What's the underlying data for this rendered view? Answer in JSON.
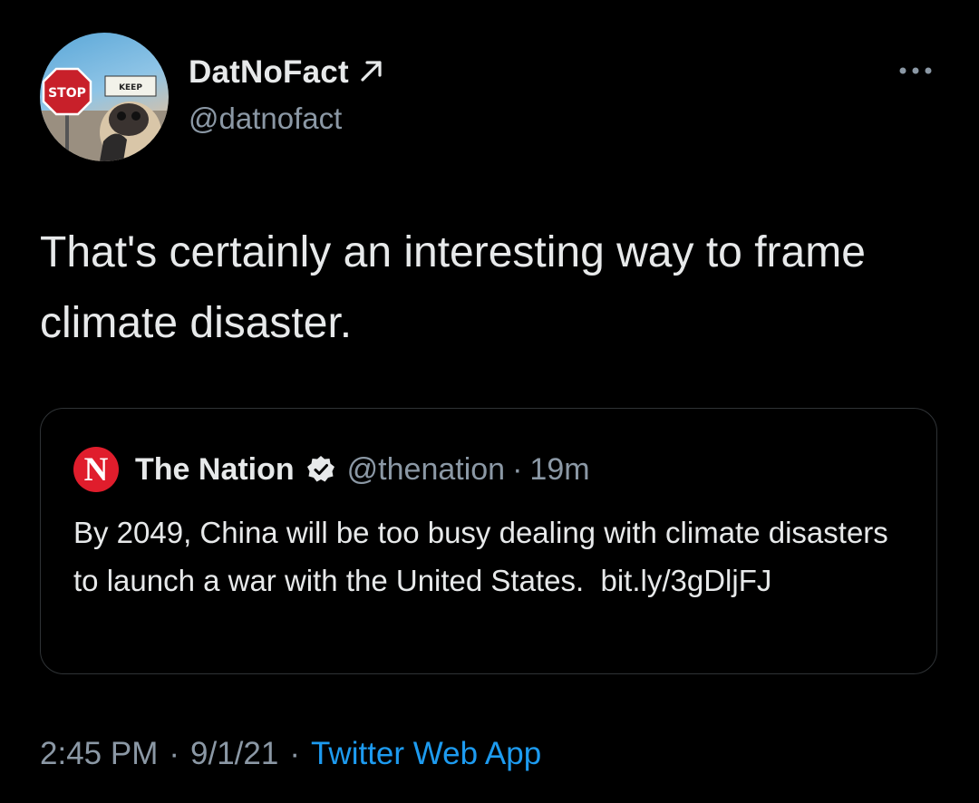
{
  "tweet": {
    "author": {
      "display_name": "DatNoFact",
      "handle": "@datnofact",
      "avatar_sign_text": "STOP",
      "avatar_sign2_text": "KEEP"
    },
    "text": "That's certainly an interesting way to frame climate disaster.",
    "quoted": {
      "logo_letter": "N",
      "name": "The Nation",
      "handle": "@thenation",
      "separator": "·",
      "time": "19m",
      "text": "By 2049, China will be too busy dealing with climate disasters to launch a war with the United States.",
      "link": "bit.ly/3gDljFJ"
    },
    "meta": {
      "time": "2:45 PM",
      "date": "9/1/21",
      "separator": "·",
      "source": "Twitter Web App"
    }
  },
  "icons": {
    "more": "more-horizontal-icon",
    "arrow": "arrow-up-right-icon",
    "verified": "verified-badge-icon"
  },
  "colors": {
    "background": "#000000",
    "text": "#e7e9ea",
    "secondary": "#8b98a5",
    "link": "#1d9bf0",
    "border": "#2f3336",
    "nation_red": "#e01d2c"
  }
}
